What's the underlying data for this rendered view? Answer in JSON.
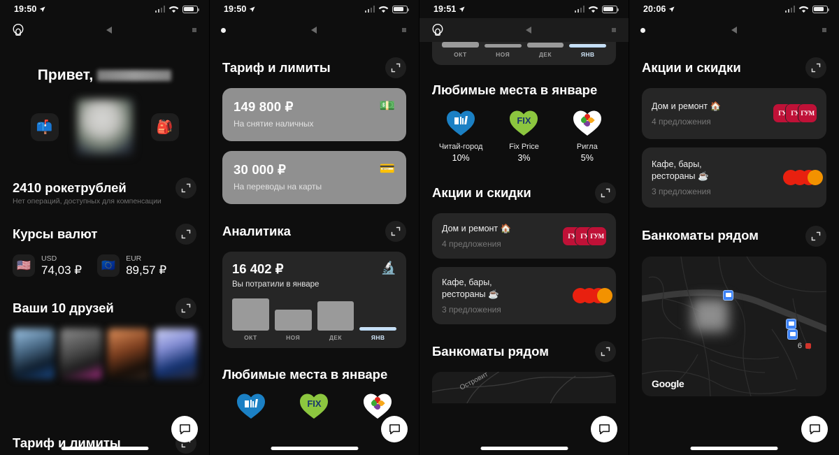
{
  "app": {
    "accent": "#bf1137",
    "bg": "#0e0e0e",
    "card_bg": "#262626",
    "limit_card_bg": "#909090",
    "highlight": "#cfe4f7"
  },
  "panels": [
    {
      "id": "panel-home",
      "status": {
        "time": "19:50",
        "location_icon": "location-arrow-icon",
        "signal_icon": "signal-bars-icon",
        "wifi_icon": "wifi-icon",
        "battery_icon": "battery-icon"
      },
      "appbar": {
        "left_icon": "account-avatar-icon",
        "center_icon": "navigation-triangle-icon",
        "right_icon": "square-dot-icon"
      },
      "greeting": {
        "hello": "Привет,",
        "name_redacted": ""
      },
      "hero": {
        "left_tile_icon": "mailbox-emoji",
        "left_tile_emoji": "📫",
        "right_tile_icon": "backpack-emoji",
        "right_tile_emoji": "🎒",
        "photo": "user-photo-blurred"
      },
      "rocket": {
        "title": "2410 рокетрублей",
        "subtitle": "Нет операций, доступных для компенсации",
        "expand_icon": "expand-icon"
      },
      "currency": {
        "title": "Курсы валют",
        "expand_icon": "expand-icon",
        "items": [
          {
            "code": "USD",
            "value": "74,03 ₽",
            "flag": "🇺🇸"
          },
          {
            "code": "EUR",
            "value": "89,57 ₽",
            "flag": "🇪🇺"
          }
        ]
      },
      "friends": {
        "title": "Ваши 10 друзей",
        "expand_icon": "expand-icon",
        "count": 4
      },
      "cut_title": "Тариф и лимиты",
      "fab_icon": "chat-bubble-icon"
    },
    {
      "id": "panel-limits",
      "status": {
        "time": "19:50"
      },
      "appbar": {
        "left_icon": "page-dot-icon",
        "center_icon": "navigation-triangle-icon",
        "right_icon": "square-dot-icon"
      },
      "limits": {
        "title": "Тариф и лимиты",
        "expand_icon": "expand-icon",
        "cards": [
          {
            "amount": "149 800 ₽",
            "label": "На снятие наличных",
            "emoji": "💵",
            "icon": "cash-emoji"
          },
          {
            "amount": "30 000 ₽",
            "label": "На переводы на карты",
            "emoji": "💳",
            "icon": "credit-card-emoji"
          }
        ]
      },
      "analytics": {
        "title": "Аналитика",
        "expand_icon": "expand-icon",
        "amount": "16 402 ₽",
        "subtitle": "Вы потратили в январе",
        "emoji": "🔬",
        "icon": "microscope-emoji"
      },
      "places": {
        "title": "Любимые места в январе"
      },
      "fab_icon": "chat-bubble-icon"
    },
    {
      "id": "panel-places-offers",
      "status": {
        "time": "19:51"
      },
      "appbar": {
        "left_icon": "account-avatar-icon",
        "center_icon": "navigation-triangle-icon",
        "right_icon": "square-dot-icon"
      },
      "places": {
        "title": "Любимые места в январе",
        "items": [
          {
            "name": "Читай-город",
            "percent": "10%",
            "color": "#1b80c4",
            "glyph": "books",
            "icon": "chitai-gorod-heart-icon"
          },
          {
            "name": "Fix Price",
            "percent": "3%",
            "color": "#8cc63f",
            "glyph": "FIX",
            "icon": "fix-price-heart-icon"
          },
          {
            "name": "Ригла",
            "percent": "5%",
            "color": "#ffffff",
            "glyph": "flower",
            "icon": "rigla-heart-icon"
          }
        ]
      },
      "offers": {
        "title": "Акции и скидки",
        "expand_icon": "expand-icon",
        "items": [
          {
            "title": "Дом и ремонт 🏠",
            "sub": "4 предложения",
            "logos": "gum",
            "logo_count": 3
          },
          {
            "title": "Кафе, бары,\nрестораны ☕",
            "sub": "3 предложения",
            "logos": "mastercard",
            "logo_count": 3
          }
        ]
      },
      "atms": {
        "title": "Банкоматы рядом",
        "expand_icon": "expand-icon",
        "map_label": "Островит"
      },
      "fab_icon": "chat-bubble-icon"
    },
    {
      "id": "panel-offers-atms",
      "status": {
        "time": "20:06"
      },
      "appbar": {
        "left_icon": "page-dot-icon",
        "center_icon": "navigation-triangle-icon",
        "right_icon": "square-dot-icon"
      },
      "offers": {
        "title": "Акции и скидки",
        "expand_icon": "expand-icon",
        "items": [
          {
            "title": "Дом и ремонт 🏠",
            "sub": "4 предложения",
            "logos": "gum",
            "logo_count": 3
          },
          {
            "title": "Кафе, бары,\nрестораны ☕",
            "sub": "3 предложения",
            "logos": "mastercard",
            "logo_count": 3
          }
        ]
      },
      "atms": {
        "title": "Банкоматы рядом",
        "expand_icon": "expand-icon",
        "map_attribution": "Google",
        "marker_count": "6",
        "pin_icon": "atm-pin-icon"
      },
      "fab_icon": "chat-bubble-icon"
    }
  ],
  "chart_data": {
    "type": "bar",
    "title": "Аналитика — Вы потратили в январе",
    "categories": [
      "ОКТ",
      "НОЯ",
      "ДЕК",
      "ЯНВ"
    ],
    "values": [
      34,
      22,
      31,
      3
    ],
    "unit": "₽",
    "highlight_index": 3,
    "total_label": "16 402 ₽",
    "xlabel": "",
    "ylabel": "",
    "ylim": [
      0,
      40
    ],
    "grid": false,
    "legend": "none"
  },
  "gum_logo_text": "ГУМ"
}
